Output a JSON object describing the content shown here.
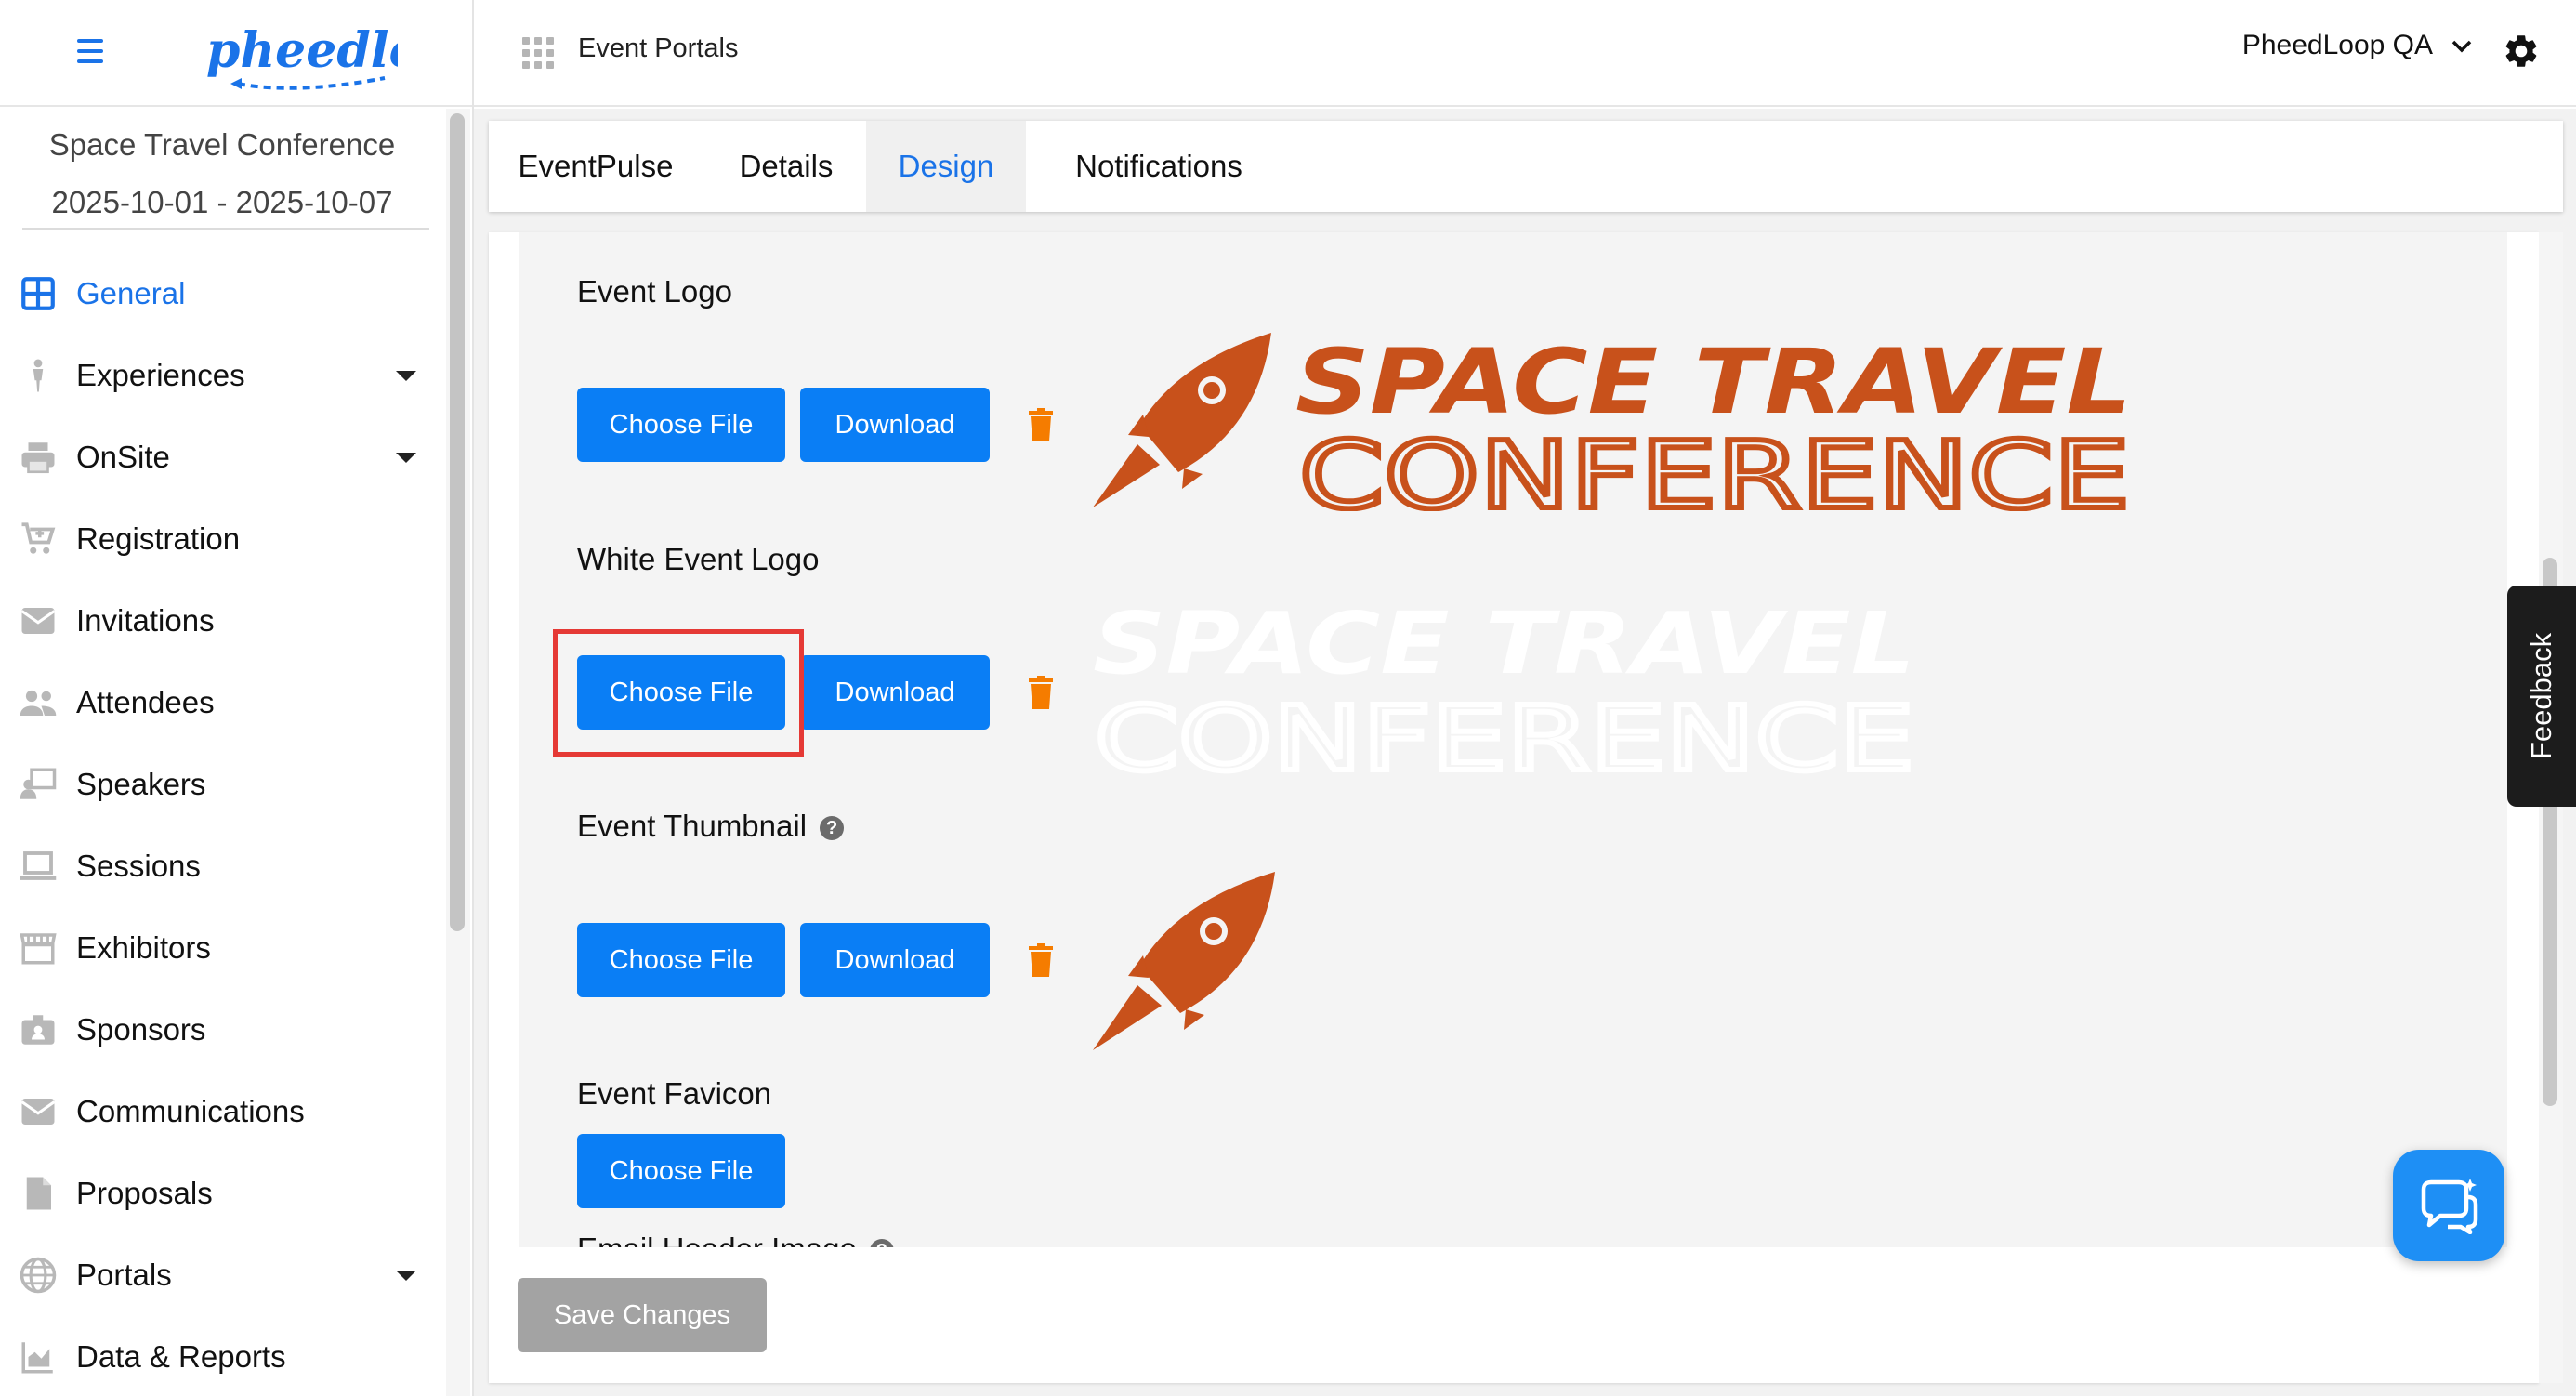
{
  "header": {
    "app_title": "Event Portals",
    "org_name": "PheedLoop QA",
    "logo_text": "pheedloop"
  },
  "sidebar": {
    "event_name": "Space Travel Conference",
    "event_dates": "2025-10-01 - 2025-10-07",
    "items": [
      {
        "label": "General",
        "icon": "grid-icon",
        "active": true,
        "has_caret": false
      },
      {
        "label": "Experiences",
        "icon": "person-icon",
        "active": false,
        "has_caret": true
      },
      {
        "label": "OnSite",
        "icon": "printer-icon",
        "active": false,
        "has_caret": true
      },
      {
        "label": "Registration",
        "icon": "cart-icon",
        "active": false,
        "has_caret": false
      },
      {
        "label": "Invitations",
        "icon": "envelope-icon",
        "active": false,
        "has_caret": false
      },
      {
        "label": "Attendees",
        "icon": "people-icon",
        "active": false,
        "has_caret": false
      },
      {
        "label": "Speakers",
        "icon": "presenter-icon",
        "active": false,
        "has_caret": false
      },
      {
        "label": "Sessions",
        "icon": "laptop-icon",
        "active": false,
        "has_caret": false
      },
      {
        "label": "Exhibitors",
        "icon": "storefront-icon",
        "active": false,
        "has_caret": false
      },
      {
        "label": "Sponsors",
        "icon": "badge-icon",
        "active": false,
        "has_caret": false
      },
      {
        "label": "Communications",
        "icon": "envelope-icon",
        "active": false,
        "has_caret": false
      },
      {
        "label": "Proposals",
        "icon": "document-icon",
        "active": false,
        "has_caret": false
      },
      {
        "label": "Portals",
        "icon": "globe-icon",
        "active": false,
        "has_caret": true
      },
      {
        "label": "Data & Reports",
        "icon": "chart-icon",
        "active": false,
        "has_caret": false
      }
    ]
  },
  "tabs": [
    {
      "label": "EventPulse",
      "active": false
    },
    {
      "label": "Details",
      "active": false
    },
    {
      "label": "Design",
      "active": true
    },
    {
      "label": "Notifications",
      "active": false
    }
  ],
  "design": {
    "event_logo_label": "Event Logo",
    "white_logo_label": "White Event Logo",
    "thumbnail_label": "Event Thumbnail",
    "favicon_label": "Event Favicon",
    "email_header_label": "Email Header Image",
    "choose_file_label": "Choose File",
    "download_label": "Download",
    "logo_line1": "SPACE TRAVEL",
    "logo_line2": "CONFERENCE"
  },
  "actions": {
    "save_label": "Save Changes"
  },
  "feedback_label": "Feedback",
  "colors": {
    "accent": "#0a7ef5",
    "logo_orange": "#c8511b",
    "trash_orange": "#f57c00",
    "highlight_red": "#e53935"
  }
}
